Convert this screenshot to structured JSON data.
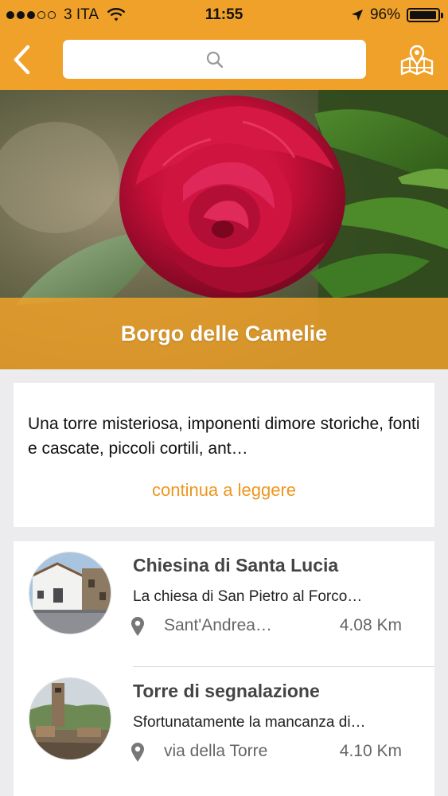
{
  "status_bar": {
    "carrier": "3 ITA",
    "time": "11:55",
    "battery": "96%",
    "battery_level": 0.96,
    "signal_bars_filled": 3,
    "signal_bars_total": 5
  },
  "nav": {
    "back_icon": "chevron-left-icon",
    "search_placeholder": "",
    "search_icon": "search-icon",
    "map_icon": "map-pin-icon"
  },
  "hero": {
    "title": "Borgo delle Camelie"
  },
  "description": {
    "text": "Una torre misteriosa, imponenti dimore storiche, fonti e cascate, piccoli cortili, ant…",
    "read_more_label": "continua a leggere"
  },
  "places": [
    {
      "title": "Chiesina di Santa Lucia",
      "subtitle": "La chiesa di San Pietro al Forco…",
      "location": "Sant'Andrea…",
      "distance": "4.08 Km"
    },
    {
      "title": "Torre di segnalazione",
      "subtitle": "Sfortunatamente la mancanza di…",
      "location": "via della Torre",
      "distance": "4.10 Km"
    }
  ],
  "colors": {
    "accent": "#efa12a",
    "link": "#ef961d",
    "background": "#ececef"
  }
}
